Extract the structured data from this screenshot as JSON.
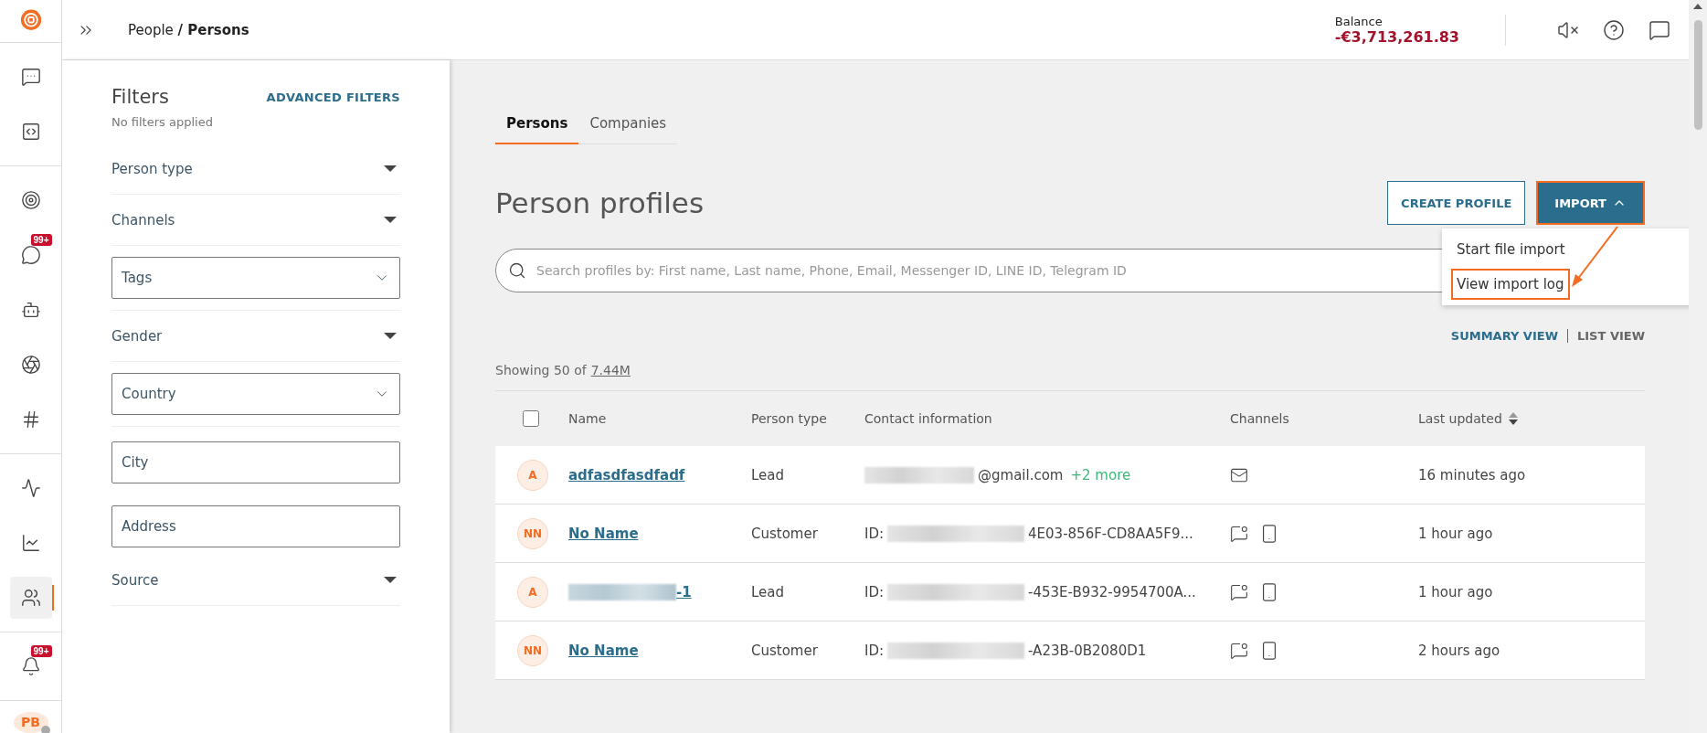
{
  "rail": {
    "groups": [
      [
        {
          "selected": false
        },
        {
          "selected": false
        }
      ],
      [
        {
          "selected": false
        },
        {
          "selected": false,
          "badge": "99+"
        },
        {
          "selected": false
        },
        {
          "selected": false
        },
        {
          "selected": false
        }
      ],
      [
        {
          "selected": false
        },
        {
          "selected": false
        },
        {
          "selected": true
        }
      ],
      [
        {
          "selected": false,
          "badge": "99+"
        }
      ]
    ],
    "avatar": "PB"
  },
  "topbar": {
    "breadcrumb": "People **/ Persons**",
    "balance_label": "Balance",
    "balance": "-€3,713,261.83"
  },
  "filters": {
    "title": "Filters",
    "advanced": "ADVANCED FILTERS",
    "status": "No filters applied",
    "items": [
      {
        "kind": "dropdown",
        "label": "Person type"
      },
      {
        "kind": "dropdown",
        "label": "Channels"
      },
      {
        "kind": "select",
        "label": "Tags"
      },
      {
        "kind": "dropdown",
        "label": "Gender"
      },
      {
        "kind": "select",
        "label": "Country"
      },
      {
        "kind": "input",
        "placeholder": "City"
      },
      {
        "kind": "input",
        "placeholder": "Address"
      },
      {
        "kind": "dropdown",
        "label": "Source"
      }
    ]
  },
  "tabs": [
    {
      "label": "Persons",
      "selected": true
    },
    {
      "label": "Companies",
      "selected": false
    }
  ],
  "heading": "Person profiles",
  "buttons": {
    "create": "CREATE PROFILE",
    "import": "IMPORT",
    "import_highlighted": true
  },
  "import_menu": {
    "expanded": true,
    "items": [
      {
        "label": "Start file import",
        "highlighted": false
      },
      {
        "label": "View import log",
        "highlighted": true
      }
    ]
  },
  "search": {
    "placeholder": "Search profiles by: First name, Last name, Phone, Email, Messenger ID, LINE ID, Telegram ID"
  },
  "views": [
    {
      "label": "SUMMARY VIEW",
      "selected": true
    },
    {
      "label": "LIST VIEW",
      "selected": false
    }
  ],
  "showing": {
    "text": "Showing 50 of",
    "total": "7.44M"
  },
  "table": {
    "select_all_checked": false,
    "columns": [
      "Name",
      "Person type",
      "Contact information",
      "Channels",
      "Last updated"
    ],
    "rows": [
      {
        "initials": "A",
        "name": "adfasdfasdfadf",
        "name_redacted": false,
        "type": "Lead",
        "contact_prefix": "",
        "contact": "@gmail.com",
        "extra": "+2 more",
        "channels": [
          {
            "kind": "email"
          }
        ],
        "updated": "16 minutes ago"
      },
      {
        "initials": "NN",
        "name": "No Name",
        "name_redacted": false,
        "type": "Customer",
        "contact_prefix": "ID:",
        "contact": "4E03-856F-CD8AA5F9...",
        "channels": [
          {
            "kind": "chat"
          },
          {
            "kind": "phone"
          }
        ],
        "updated": "1 hour ago"
      },
      {
        "initials": "A",
        "name": "-1",
        "name_redacted": true,
        "type": "Lead",
        "contact_prefix": "ID:",
        "contact": "-453E-B932-9954700A...",
        "channels": [
          {
            "kind": "chat"
          },
          {
            "kind": "phone"
          }
        ],
        "updated": "1 hour ago"
      },
      {
        "initials": "NN",
        "name": "No Name",
        "name_redacted": false,
        "type": "Customer",
        "contact_prefix": "ID:",
        "contact": "-A23B-0B2080D1",
        "channels": [
          {
            "kind": "chat"
          },
          {
            "kind": "phone"
          }
        ],
        "updated": "2 hours ago"
      }
    ]
  }
}
